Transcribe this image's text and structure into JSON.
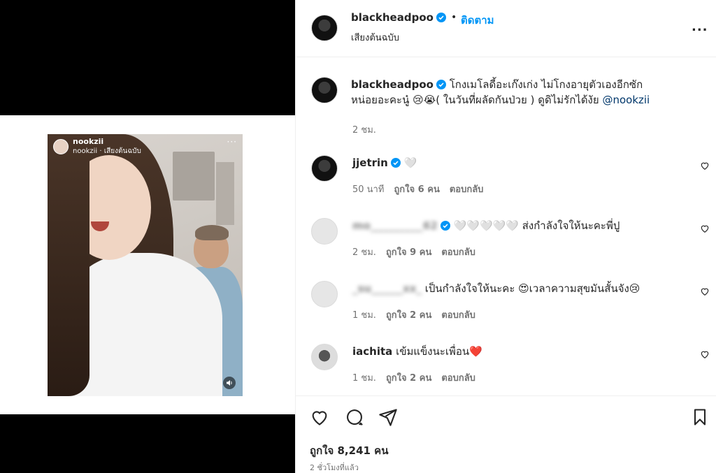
{
  "story": {
    "username": "nookzii",
    "subtitle": "nookzii · เสียงต้นฉบับ",
    "dots": "···"
  },
  "header": {
    "username": "blackheadpoo",
    "dot": "•",
    "follow_label": "ติดตาม",
    "subtitle": "เสียงต้นฉบับ",
    "more": "..."
  },
  "caption": {
    "username": "blackheadpoo",
    "text": "โกงเมโลดี้อะเก๊งเก่ง ไม่โกงอายุตัวเองอีกซักหน่อยอะคะนู๋ 😢😭( ในวันที่ผลัดกันป่วย ) ดูดิไม่รักได้งัย ",
    "mention": "@nookzii",
    "time": "2 ชม."
  },
  "comments": [
    {
      "username": "jjetrin",
      "verified": true,
      "text": "🤍",
      "time": "50 นาที",
      "likes": "ถูกใจ 6 คน",
      "reply": "ตอบกลับ",
      "blurred": false
    },
    {
      "username": "mo__________62",
      "verified": true,
      "text": "🤍🤍🤍🤍🤍 ส่งกำลังใจให้นะคะพี่ปู",
      "time": "2 ชม.",
      "likes": "ถูกใจ 9 คน",
      "reply": "ตอบกลับ",
      "blurred": true
    },
    {
      "username": "_su______xx_",
      "verified": false,
      "text": "เป็นกำลังใจให้นะคะ 😍เวลาความสุขมันสั้นจัง😢",
      "time": "1 ชม.",
      "likes": "ถูกใจ 2 คน",
      "reply": "ตอบกลับ",
      "blurred": true
    },
    {
      "username": "iachita",
      "verified": false,
      "text": "เข้มแข็งนะเพื่อน❤️",
      "time": "1 ชม.",
      "likes": "ถูกใจ 2 คน",
      "reply": "ตอบกลับ",
      "blurred": false
    }
  ],
  "footer": {
    "likes": "ถูกใจ 8,241 คน",
    "ago": "2 ชั่วโมงที่แล้ว"
  },
  "colors": {
    "accent": "#0095f6",
    "verified": "#0095f6",
    "muted": "#737373"
  }
}
